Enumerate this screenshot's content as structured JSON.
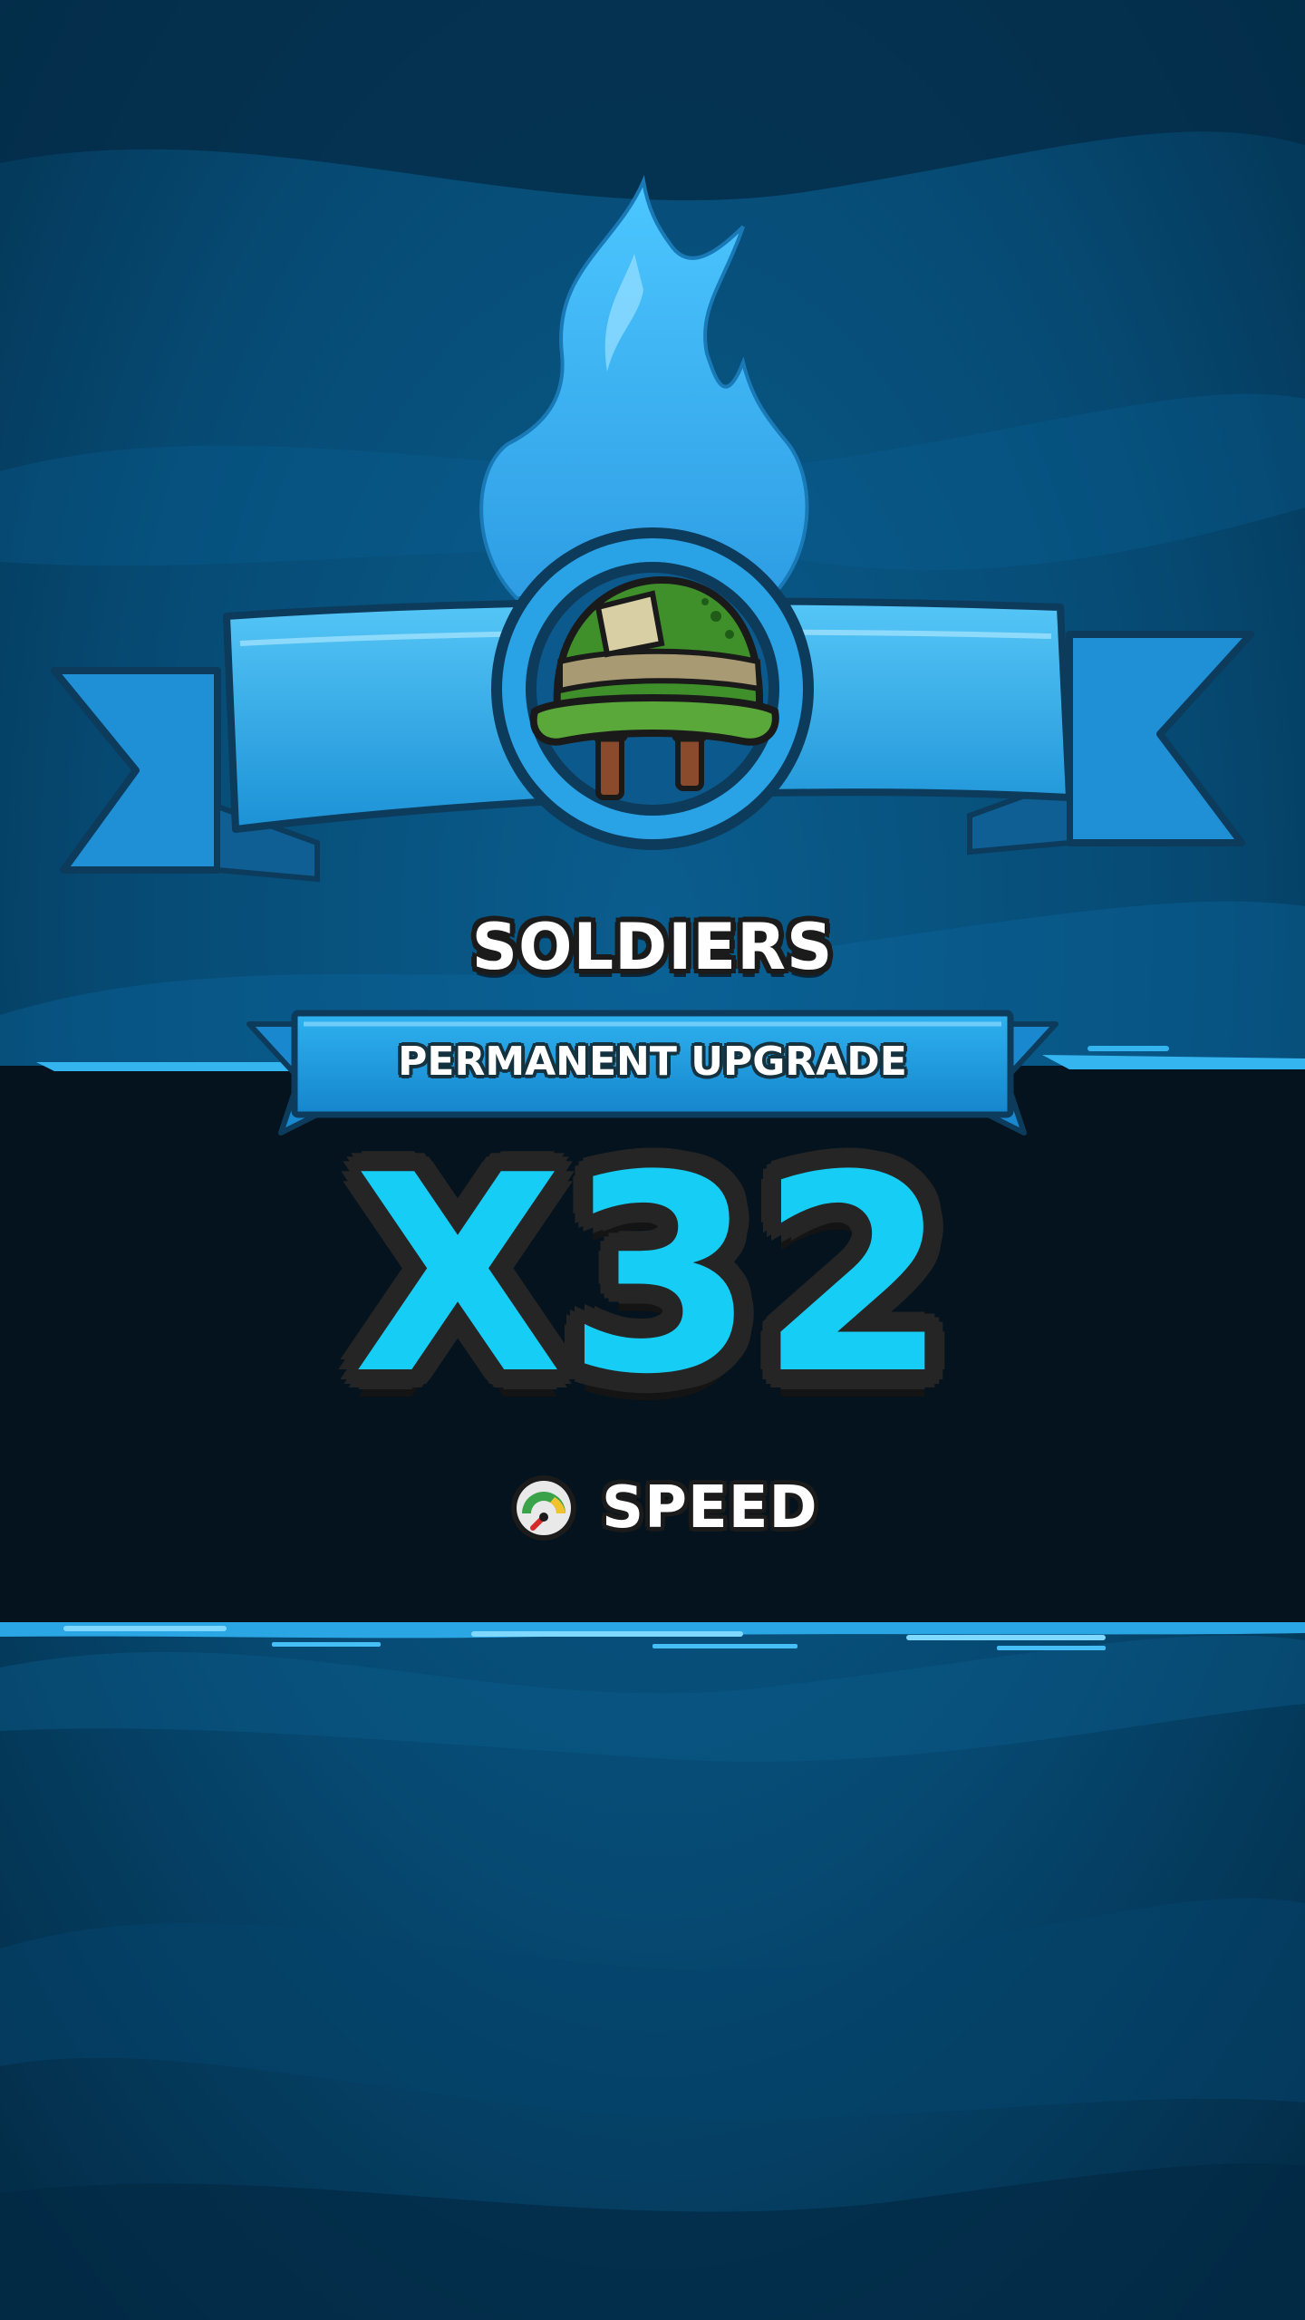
{
  "reward": {
    "unit_name": "SOLDIERS",
    "banner_text": "PERMANENT UPGRADE",
    "multiplier": "X32",
    "stat": {
      "label": "SPEED",
      "icon": "speedometer-icon"
    },
    "unit_icon": "army-helmet-icon",
    "effect_icon": "blue-flame-icon"
  },
  "colors": {
    "background": "#05324f",
    "dark_band": "#04131d",
    "ribbon": "#1e9ad9",
    "accent": "#16cdf5",
    "helmet": "#3f8f2a"
  }
}
